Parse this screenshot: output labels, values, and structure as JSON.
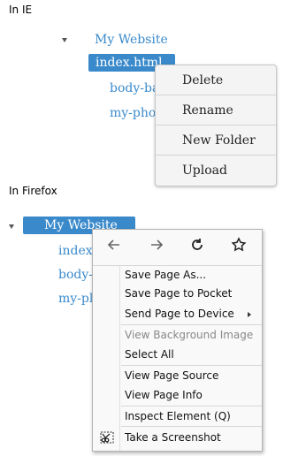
{
  "ie_section": {
    "label": "In IE",
    "tree": {
      "root": "My Website",
      "items": [
        "index.html",
        "body-ba",
        "my-phot"
      ]
    },
    "context_menu": [
      "Delete",
      "Rename",
      "New Folder",
      "Upload"
    ]
  },
  "firefox_section": {
    "label": "In Firefox",
    "tree": {
      "root": "My Website",
      "items": [
        "index.",
        "body-",
        "my-pl"
      ]
    },
    "context_menu": {
      "nav_icons": [
        "back-arrow-icon",
        "forward-arrow-icon",
        "reload-icon",
        "bookmark-star-icon"
      ],
      "groups": [
        [
          "Save Page As...",
          "Save Page to Pocket",
          "Send Page to Device"
        ],
        [
          "View Background Image",
          "Select All"
        ],
        [
          "View Page Source",
          "View Page Info"
        ],
        [
          "Inspect Element (Q)",
          "Take a Screenshot"
        ]
      ]
    }
  },
  "colors": {
    "accent": "#3a8acb",
    "menu_bg_ie": "#f4f4f4",
    "menu_bg_ff": "#f9f9fa"
  }
}
